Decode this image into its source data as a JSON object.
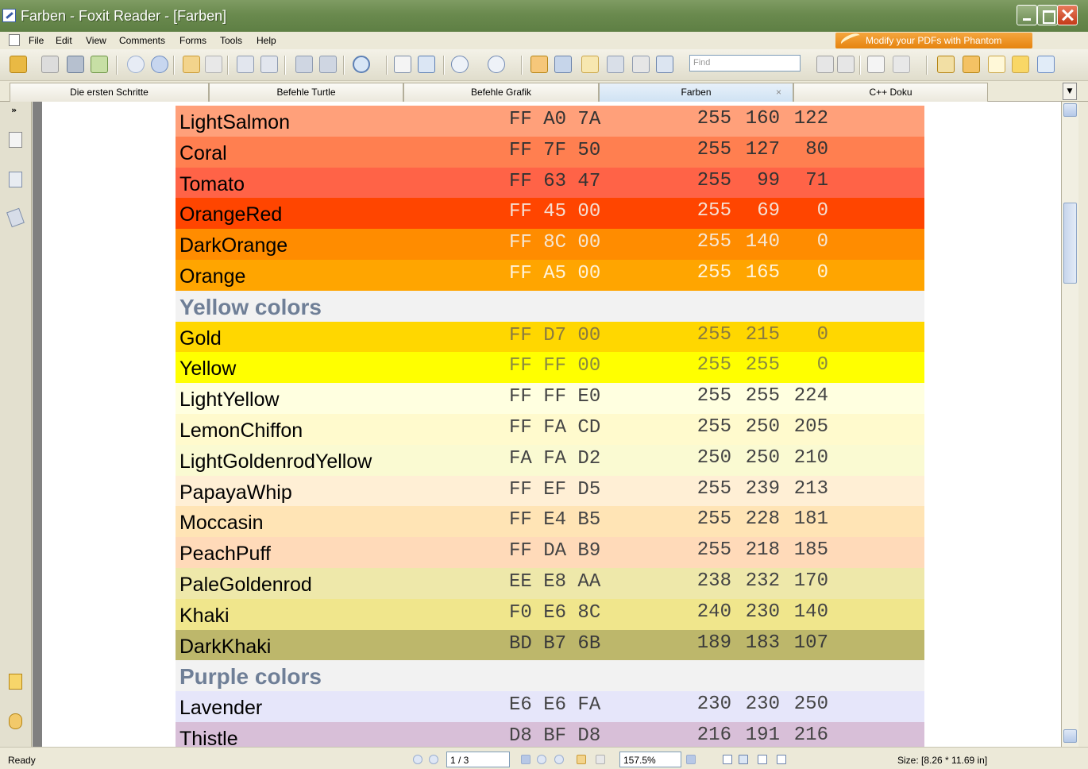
{
  "window": {
    "title": "Farben - Foxit Reader - [Farben]"
  },
  "menu": {
    "items": [
      "File",
      "Edit",
      "View",
      "Comments",
      "Forms",
      "Tools",
      "Help"
    ],
    "promo": "Modify your PDFs with Phantom"
  },
  "toolbar": {
    "find_placeholder": "Find"
  },
  "tabs": [
    {
      "label": "Die ersten Schritte",
      "active": false
    },
    {
      "label": "Befehle Turtle",
      "active": false
    },
    {
      "label": "Befehle Grafik",
      "active": false
    },
    {
      "label": "Farben",
      "active": true,
      "close": "×"
    },
    {
      "label": "C++ Doku",
      "active": false
    }
  ],
  "left_panel": {
    "expand": "»"
  },
  "document": {
    "rows": [
      {
        "name": "LightSalmon",
        "hex": "FF A0 7A",
        "r": "255",
        "g": "160",
        "b": "122",
        "bg": "#FFA07A",
        "fg": "#333333"
      },
      {
        "name": "Coral",
        "hex": "FF 7F 50",
        "r": "255",
        "g": "127",
        "b": "80",
        "bg": "#FF7F50",
        "fg": "#333333"
      },
      {
        "name": "Tomato",
        "hex": "FF 63 47",
        "r": "255",
        "g": "99",
        "b": "71",
        "bg": "#FF6347",
        "fg": "#333333"
      },
      {
        "name": "OrangeRed",
        "hex": "FF 45 00",
        "r": "255",
        "g": "69",
        "b": "0",
        "bg": "#FF4500",
        "fg": "#f6ded2"
      },
      {
        "name": "DarkOrange",
        "hex": "FF 8C 00",
        "r": "255",
        "g": "140",
        "b": "0",
        "bg": "#FF8C00",
        "fg": "#f6e6d2"
      },
      {
        "name": "Orange",
        "hex": "FF A5 00",
        "r": "255",
        "g": "165",
        "b": "0",
        "bg": "#FFA500",
        "fg": "#fff2d8"
      },
      {
        "name": "Yellow colors",
        "heading": true,
        "bg": "#F2F2F2"
      },
      {
        "name": "Gold",
        "hex": "FF D7 00",
        "r": "255",
        "g": "215",
        "b": "0",
        "bg": "#FFD700",
        "fg": "#8a7a40"
      },
      {
        "name": "Yellow",
        "hex": "FF FF 00",
        "r": "255",
        "g": "255",
        "b": "0",
        "bg": "#FFFF00",
        "fg": "#8a8a40"
      },
      {
        "name": "LightYellow",
        "hex": "FF FF E0",
        "r": "255",
        "g": "255",
        "b": "224",
        "bg": "#FFFFE0",
        "fg": "#444444"
      },
      {
        "name": "LemonChiffon",
        "hex": "FF FA CD",
        "r": "255",
        "g": "250",
        "b": "205",
        "bg": "#FFFACD",
        "fg": "#444444"
      },
      {
        "name": "LightGoldenrodYellow",
        "hex": "FA FA D2",
        "r": "250",
        "g": "250",
        "b": "210",
        "bg": "#FAFAD2",
        "fg": "#444444"
      },
      {
        "name": "PapayaWhip",
        "hex": "FF EF D5",
        "r": "255",
        "g": "239",
        "b": "213",
        "bg": "#FFEFD5",
        "fg": "#444444"
      },
      {
        "name": "Moccasin",
        "hex": "FF E4 B5",
        "r": "255",
        "g": "228",
        "b": "181",
        "bg": "#FFE4B5",
        "fg": "#444444"
      },
      {
        "name": "PeachPuff",
        "hex": "FF DA B9",
        "r": "255",
        "g": "218",
        "b": "185",
        "bg": "#FFDAB9",
        "fg": "#444444"
      },
      {
        "name": "PaleGoldenrod",
        "hex": "EE E8 AA",
        "r": "238",
        "g": "232",
        "b": "170",
        "bg": "#EEE8AA",
        "fg": "#444444"
      },
      {
        "name": "Khaki",
        "hex": "F0 E6 8C",
        "r": "240",
        "g": "230",
        "b": "140",
        "bg": "#F0E68C",
        "fg": "#444444"
      },
      {
        "name": "DarkKhaki",
        "hex": "BD B7 6B",
        "r": "189",
        "g": "183",
        "b": "107",
        "bg": "#BDB76B",
        "fg": "#3a3a3a"
      },
      {
        "name": "Purple colors",
        "heading": true,
        "bg": "#F2F2F2"
      },
      {
        "name": "Lavender",
        "hex": "E6 E6 FA",
        "r": "230",
        "g": "230",
        "b": "250",
        "bg": "#E6E6FA",
        "fg": "#444444"
      },
      {
        "name": "Thistle",
        "hex": "D8 BF D8",
        "r": "216",
        "g": "191",
        "b": "216",
        "bg": "#D8BFD8",
        "fg": "#444444"
      }
    ]
  },
  "status": {
    "state": "Ready",
    "page": "1 / 3",
    "zoom": "157.5%",
    "size": "Size: [8.26 * 11.69 in]"
  },
  "colors": {
    "titlebar": "#6a8a4e",
    "promo": "#e6840f",
    "heading_text": "#6f7f97"
  }
}
